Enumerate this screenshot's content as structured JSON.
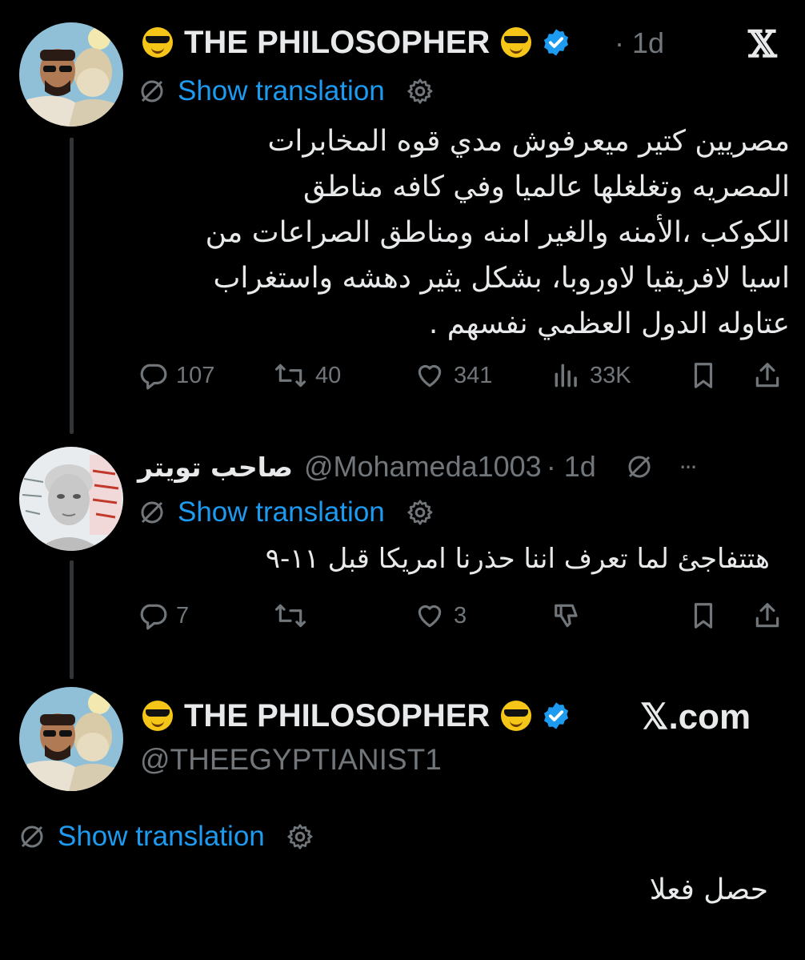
{
  "tweet1": {
    "author_name": "THE PHILOSOPHER",
    "time": "· 1d",
    "translate_label": "Show translation",
    "text": "مصريين كتير ميعرفوش مدي قوه المخابرات\nالمصريه وتغلغلها عالميا وفي كافه مناطق\nالكوكب ،الأمنه والغير امنه ومناطق الصراعات من\nاسيا لافريقيا لاوروبا، بشكل يثير دهشه واستغراب\nعتاوله الدول العظمي نفسهم .",
    "replies": "107",
    "reposts": "40",
    "likes": "341",
    "views": "33K"
  },
  "tweet2": {
    "author_name": "صاحب تويتر",
    "handle": "@Mohameda1003",
    "time": "· 1d",
    "translate_label": "Show translation",
    "text": "هتتفاجئ لما تعرف اننا حذرنا امريكا قبل ١١-٩",
    "replies": "7",
    "likes": "3",
    "more": "···"
  },
  "tweet3": {
    "author_name": "THE PHILOSOPHER",
    "handle": "@THEEGYPTIANIST1",
    "brand": "𝕏.com",
    "translate_label": "Show translation",
    "text": "حصل فعلا"
  },
  "icons": {
    "x_logo": "𝕏",
    "globe_slash": "globe-slash-icon",
    "gear": "gear-icon"
  },
  "colors": {
    "background": "#000000",
    "link": "#1d9bf0",
    "muted": "#71767b",
    "text": "#e7e9ea",
    "verified": "#1d9bf0"
  }
}
